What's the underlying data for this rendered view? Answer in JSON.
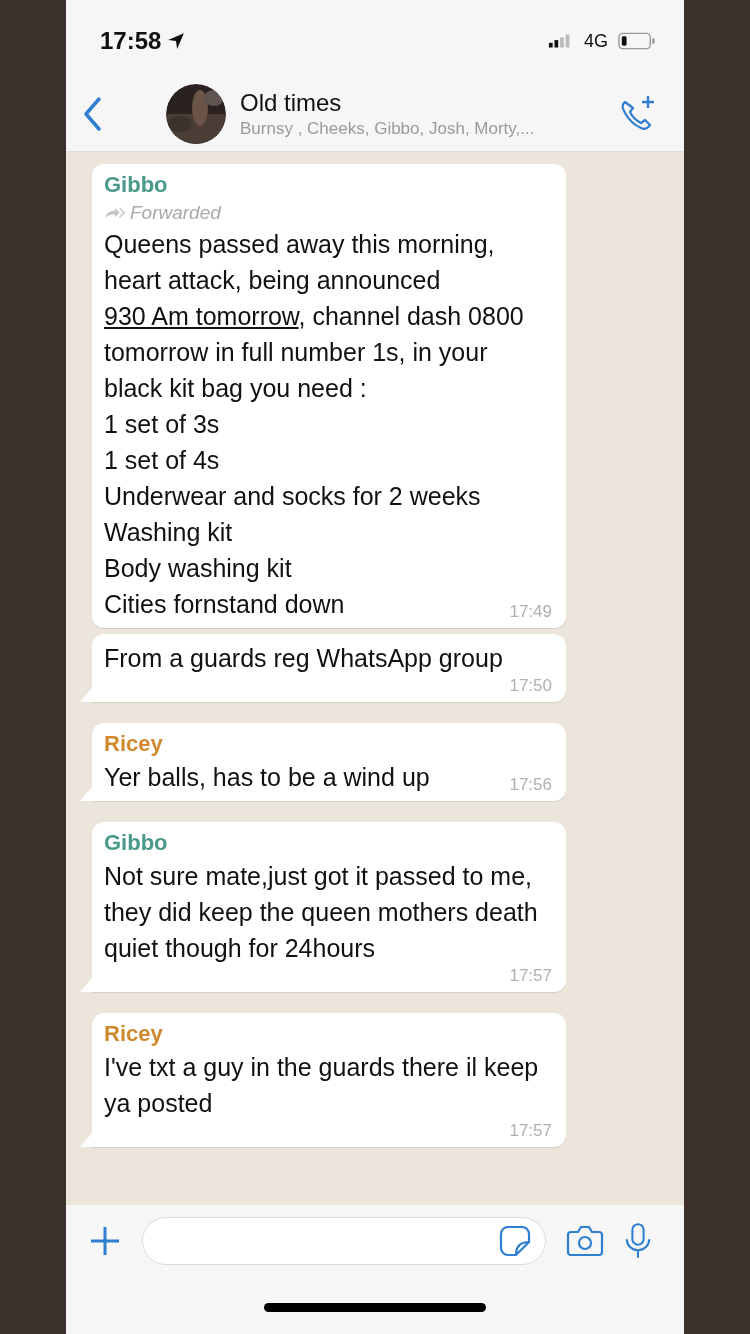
{
  "status_bar": {
    "time": "17:58",
    "network": "4G"
  },
  "header": {
    "title": "Old times",
    "subtitle": "Burnsy , Cheeks, Gibbo, Josh, Morty,..."
  },
  "messages": [
    {
      "sender": "Gibbo",
      "color": "#4a9a8c",
      "tail": false,
      "forwarded": "Forwarded",
      "rich_text": {
        "before": "Queens passed away this morning, heart attack, being announced ",
        "link": "930 Am tomorrow",
        "after": ", channel dash 0800 tomorrow in full number 1s, in your black kit bag you need :"
      },
      "lines": [
        "1 set of 3s",
        "1 set of 4s",
        "Underwear and socks for 2 weeks",
        "Washing kit",
        "Body washing kit",
        "Cities fornstand down"
      ],
      "time": "17:49"
    },
    {
      "tail": true,
      "lines": [
        "From a guards reg WhatsApp group"
      ],
      "time": "17:50"
    },
    {
      "sender": "Ricey",
      "color": "#d0892c",
      "tail": true,
      "lines": [
        "Yer balls, has to be a wind up"
      ],
      "time": "17:56"
    },
    {
      "sender": "Gibbo",
      "color": "#4a9a8c",
      "tail": true,
      "lines": [
        "Not sure mate,just got it passed to me, they did keep the queen mothers death quiet though for 24hours"
      ],
      "time": "17:57"
    },
    {
      "sender": "Ricey",
      "color": "#d0892c",
      "tail": true,
      "lines": [
        "I've txt a guy in the guards there il keep ya posted"
      ],
      "time": "17:57"
    }
  ]
}
